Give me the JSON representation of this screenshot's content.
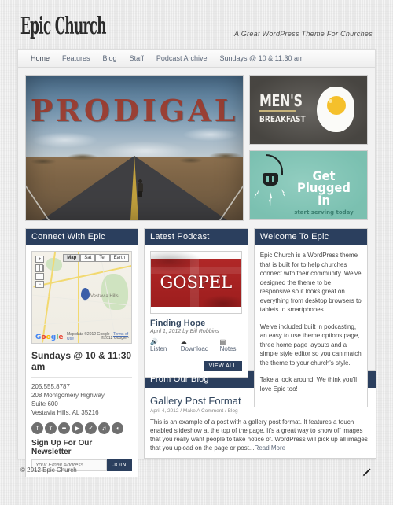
{
  "header": {
    "logo": "Epic Church",
    "tagline": "A Great WordPress Theme For Churches"
  },
  "nav": {
    "items": [
      {
        "label": "Home",
        "active": true
      },
      {
        "label": "Features",
        "active": false
      },
      {
        "label": "Blog",
        "active": false
      },
      {
        "label": "Staff",
        "active": false
      },
      {
        "label": "Podcast Archive",
        "active": false
      },
      {
        "label": "Sundays @ 10 & 11:30 am",
        "active": false
      }
    ]
  },
  "slider": {
    "headline": "PRODIGAL",
    "alt": "Man walking down a desert highway"
  },
  "banners": [
    {
      "id": "mens-breakfast",
      "line1": "MEN'S",
      "line2": "BREAKFAST",
      "bg": "#57544f",
      "accent": "#f5c02b"
    },
    {
      "id": "get-plugged-in",
      "line1": "Get",
      "line2": "Plugged In",
      "line3": "start serving today",
      "bg": "#7dc4b4",
      "accent": "#3b7f70"
    }
  ],
  "connect": {
    "title": "Connect With Epic",
    "map": {
      "modes": [
        "Map",
        "Sat",
        "Ter",
        "Earth"
      ],
      "active_mode": "Map",
      "place_label": "Vestavia Hills",
      "zoom_in": "+",
      "zoom_out": "−",
      "brand": "Google",
      "copyright": "©2012 Google -",
      "attribution": "Map data ©2012 Google -",
      "terms": "Terms of Use"
    },
    "service_times": "Sundays @ 10 & 11:30 am",
    "address": [
      "205.555.8787",
      "208 Montgomery Highway",
      "Suite 600",
      "Vestavia Hills, AL 35216"
    ],
    "socials": [
      {
        "name": "facebook-icon",
        "glyph": "f"
      },
      {
        "name": "twitter-icon",
        "glyph": "ᴛ"
      },
      {
        "name": "flickr-icon",
        "glyph": "••"
      },
      {
        "name": "youtube-icon",
        "glyph": "▶"
      },
      {
        "name": "check-icon",
        "glyph": "✓"
      },
      {
        "name": "music-icon",
        "glyph": "♫"
      },
      {
        "name": "rss-icon",
        "glyph": "◖"
      }
    ],
    "newsletter": {
      "title": "Sign Up For Our Newsletter",
      "placeholder": "Your Email Address",
      "value": "",
      "button": "JOIN"
    }
  },
  "podcast": {
    "title": "Latest Podcast",
    "artwork_text": "GOSPEL",
    "episode_title": "Finding Hope",
    "meta": "April 1, 2012 by Bill Robbins",
    "links": [
      {
        "label": "Listen",
        "icon": "speaker-icon",
        "glyph": "🔊"
      },
      {
        "label": "Download",
        "icon": "cloud-download-icon",
        "glyph": "☁"
      },
      {
        "label": "Notes",
        "icon": "document-icon",
        "glyph": "▤"
      }
    ],
    "view_all": "VIEW ALL"
  },
  "welcome": {
    "title": "Welcome To Epic",
    "paragraphs": [
      "Epic Church is a WordPress theme that is built for to help churches connect with their community. We've designed the theme to be responsive so it looks great on everything from desktop browsers to tablets to smartphones.",
      "We've included built in podcasting, an easy to use theme options page, three home page layouts and a simple style editor so you can match the theme to your church's style.",
      "Take a look around. We think you'll love Epic too!"
    ]
  },
  "blog": {
    "title": "From Our Blog",
    "post_title": "Gallery Post Format",
    "post_meta": "April 4, 2012 / Make A Comment / Blog",
    "excerpt": "This is an example of a post with a gallery post format. It features a touch enabled slideshow at the top of the page. It's a great way to show off images that you really want people to take notice of. WordPress will pick up all images that you upload on the page or post...",
    "read_more": "Read More"
  },
  "footer": {
    "copyright": "© 2012 Epic Church",
    "edit_icon": "pencil-icon"
  },
  "colors": {
    "widget_header": "#2b3f5e",
    "page_bg": "#e9e9e9",
    "link": "#5b6779"
  }
}
